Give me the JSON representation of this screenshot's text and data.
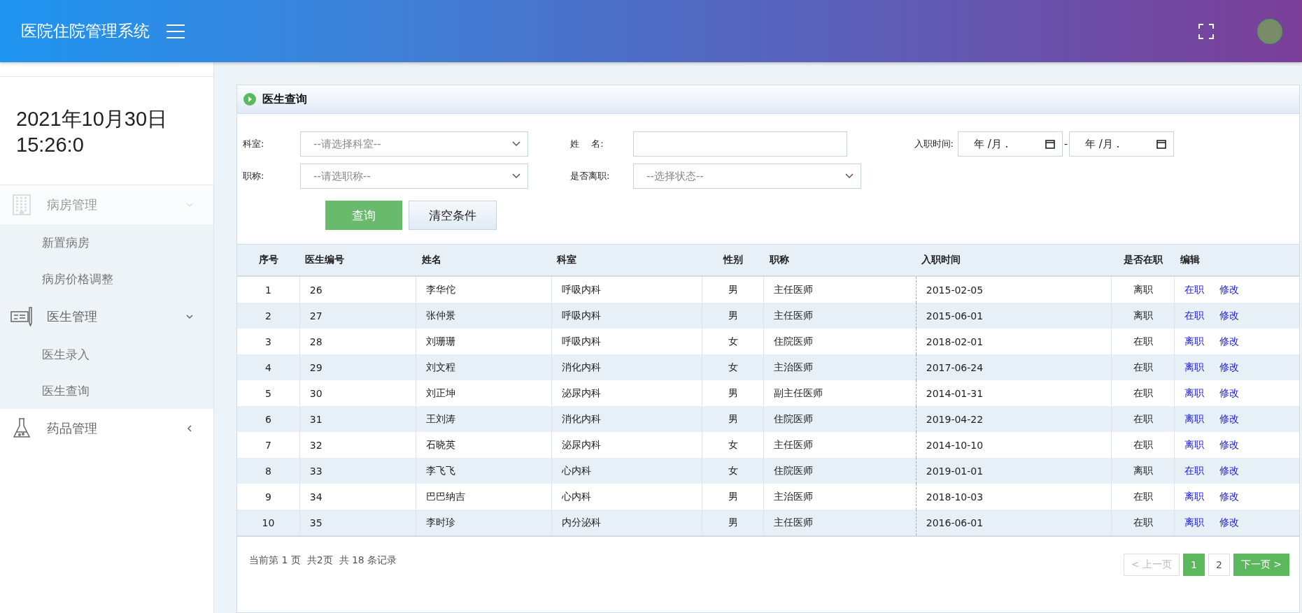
{
  "header": {
    "title": "医院住院管理系统"
  },
  "sidebar": {
    "datetime_date": "2021年10月30日",
    "datetime_time": "15:26:0",
    "menu": [
      {
        "label": "病房管理",
        "expanded": true,
        "faded": true,
        "children": [
          {
            "label": "新置病房"
          },
          {
            "label": "病房价格调整"
          }
        ]
      },
      {
        "label": "医生管理",
        "expanded": true,
        "faded": false,
        "children": [
          {
            "label": "医生录入"
          },
          {
            "label": "医生查询"
          }
        ]
      },
      {
        "label": "药品管理",
        "expanded": false,
        "faded": false
      }
    ]
  },
  "panel": {
    "title": "医生查询"
  },
  "filters": {
    "department": {
      "label": "科室:",
      "placeholder": "--请选择科室--"
    },
    "name": {
      "label": "姓　 名:"
    },
    "hire_date": {
      "label": "入职时间:",
      "from": "年 /月 .",
      "separator": "-",
      "to": "年 /月 ."
    },
    "title": {
      "label": "职称:",
      "placeholder": "--请选职称--"
    },
    "resigned": {
      "label": "是否离职:",
      "placeholder": "--选择状态--"
    },
    "buttons": [
      {
        "label": "查询",
        "kind": "primary"
      },
      {
        "label": "清空条件",
        "kind": "secondary"
      }
    ]
  },
  "table": {
    "columns": [
      "序号",
      "医生编号",
      "姓名",
      "科室",
      "性别",
      "职称",
      "入职时间",
      "是否在职",
      "编辑"
    ],
    "rows": [
      {
        "cells": [
          "1",
          "26",
          "李华佗",
          "呼吸内科",
          "男",
          "主任医师",
          "2015-02-05",
          "离职"
        ],
        "actions": [
          "在职",
          "修改"
        ]
      },
      {
        "cells": [
          "2",
          "27",
          "张仲景",
          "呼吸内科",
          "男",
          "主任医师",
          "2015-06-01",
          "离职"
        ],
        "actions": [
          "在职",
          "修改"
        ]
      },
      {
        "cells": [
          "3",
          "28",
          "刘珊珊",
          "呼吸内科",
          "女",
          "住院医师",
          "2018-02-01",
          "在职"
        ],
        "actions": [
          "离职",
          "修改"
        ]
      },
      {
        "cells": [
          "4",
          "29",
          "刘文程",
          "消化内科",
          "女",
          "主治医师",
          "2017-06-24",
          "在职"
        ],
        "actions": [
          "离职",
          "修改"
        ]
      },
      {
        "cells": [
          "5",
          "30",
          "刘正坤",
          "泌尿内科",
          "男",
          "副主任医师",
          "2014-01-31",
          "在职"
        ],
        "actions": [
          "离职",
          "修改"
        ]
      },
      {
        "cells": [
          "6",
          "31",
          "王刘涛",
          "消化内科",
          "男",
          "住院医师",
          "2019-04-22",
          "在职"
        ],
        "actions": [
          "离职",
          "修改"
        ]
      },
      {
        "cells": [
          "7",
          "32",
          "石晓英",
          "泌尿内科",
          "女",
          "主任医师",
          "2014-10-10",
          "在职"
        ],
        "actions": [
          "离职",
          "修改"
        ]
      },
      {
        "cells": [
          "8",
          "33",
          "李飞飞",
          "心内科",
          "女",
          "住院医师",
          "2019-01-01",
          "离职"
        ],
        "actions": [
          "在职",
          "修改"
        ]
      },
      {
        "cells": [
          "9",
          "34",
          "巴巴纳吉",
          "心内科",
          "男",
          "主治医师",
          "2018-10-03",
          "在职"
        ],
        "actions": [
          "离职",
          "修改"
        ]
      },
      {
        "cells": [
          "10",
          "35",
          "李时珍",
          "内分泌科",
          "男",
          "主任医师",
          "2016-06-01",
          "在职"
        ],
        "actions": [
          "离职",
          "修改"
        ]
      }
    ]
  },
  "pagination": {
    "summary": "当前第 1 页  共2页  共 18 条记录",
    "prev": {
      "label": "< 上一页",
      "disabled": true
    },
    "pages": [
      {
        "label": "1",
        "selected": true
      },
      {
        "label": "2",
        "selected": false
      }
    ],
    "next": {
      "label": "下一页 >",
      "disabled": false
    }
  }
}
